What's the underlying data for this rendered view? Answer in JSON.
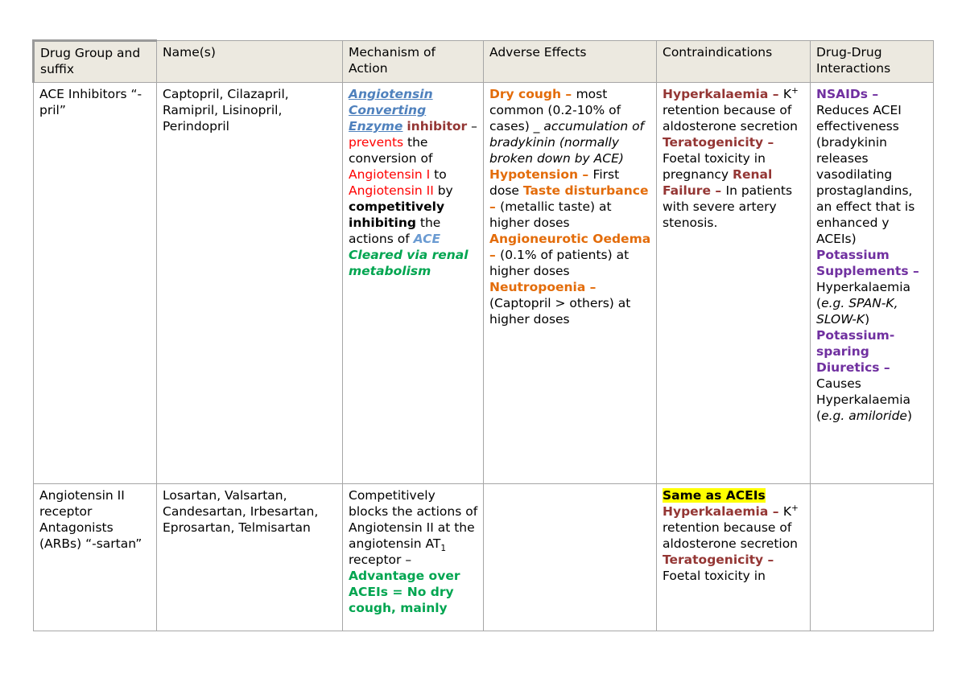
{
  "table": {
    "headers": [
      "Drug Group and suffix",
      "Name(s)",
      "Mechanism of Action",
      "Adverse Effects",
      "Contraindications",
      "Drug-Drug Interactions"
    ],
    "colors": {
      "header_background": "#ece9e0",
      "border": "#a6a6a6",
      "heading_orange": "#e36c0a",
      "heading_darkred": "#943634",
      "heading_purple": "#7030a0",
      "heading_green": "#00a550",
      "accent_red": "#ff0000",
      "accent_blue": "#4f81bd",
      "highlight_yellow": "#ffff00"
    },
    "rows": [
      {
        "group": "ACE Inhibitors “-pril”",
        "names": "Captopril, Cilazapril, Ramipril, Lisinopril, Perindopril",
        "mechanism": {
          "r1": "Angiotensin Converting Enzyme",
          "r2": "inhibitor",
          "r3": " – ",
          "r4": "prevents",
          "r5": " the conversion of ",
          "r6": "Angiotensin I",
          "r7": " to ",
          "r8": "Angiotensin II",
          "r9": " by ",
          "r10": "competitively inhibiting",
          "r11": " the actions of ",
          "r12": "ACE",
          "r13": "Cleared via renal metabolism"
        },
        "adverse": {
          "h1": "Dry cough – ",
          "t1": "most common (0.2-10% of cases) _ ",
          "t1i": "accumulation of bradykinin (normally broken down by ACE)",
          "h2": "Hypotension – ",
          "t2": "First dose",
          "h3": "Taste disturbance – ",
          "t3": "(metallic taste) at higher doses",
          "h4": "Angioneurotic Oedema – ",
          "t4": "(0.1% of patients) at higher doses",
          "h5": "Neutropoenia – ",
          "t5": "(Captopril > others) at higher doses"
        },
        "contra": {
          "h1": "Hyperkalaemia – ",
          "t1a": "K",
          "t1sup": "+",
          "t1b": " retention because of aldosterone secretion",
          "h2": "Teratogenicity – ",
          "t2": "Foetal toxicity in pregnancy",
          "h3": "Renal Failure – ",
          "t3": "In patients with severe artery stenosis."
        },
        "interactions": {
          "h1": "NSAIDs – ",
          "t1": "Reduces ACEI effectiveness (bradykinin releases vasodilating prostaglandins, an effect that is enhanced y ACEIs)",
          "h2": "Potassium Supplements – ",
          "t2": "Hyperkalaemia (",
          "t2i": "e.g. SPAN-K, SLOW-K",
          "t2c": ")",
          "h3": "Potassium-sparing Diuretics – ",
          "t3": "Causes Hyperkalaemia (",
          "t3i": "e.g. amiloride",
          "t3c": ")"
        }
      },
      {
        "group": "Angiotensin II receptor Antagonists (ARBs) “-sartan”",
        "names": "Losartan, Valsartan, Candesartan, Irbesartan, Eprosartan, Telmisartan",
        "mechanism": {
          "t1": "Competitively blocks the actions of Angiotensin II at the angiotensin AT",
          "sub1": "1",
          "t2": " receptor – ",
          "h1": "Advantage over ACEIs = No dry cough, mainly"
        },
        "adverse": "",
        "contra": {
          "hl": "Same as ACEIs",
          "h1": "Hyperkalaemia – ",
          "t1a": "K",
          "t1sup": "+",
          "t1b": " retention because of aldosterone secretion",
          "h2": "Teratogenicity – ",
          "t2": "Foetal toxicity in"
        },
        "interactions": ""
      }
    ]
  }
}
